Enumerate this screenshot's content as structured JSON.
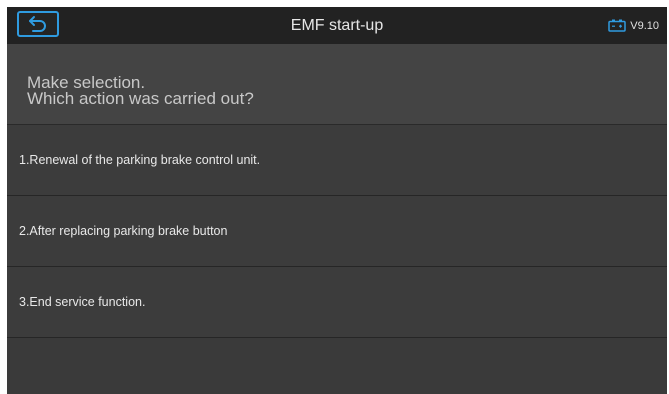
{
  "header": {
    "title": "EMF start-up",
    "version": "V9.10",
    "icons": {
      "back": "back-arrow-icon",
      "battery": "battery-icon"
    },
    "accent_color": "#2f9be0"
  },
  "prompt": {
    "line1": "Make selection.",
    "line2": "Which action was carried out?"
  },
  "options": [
    {
      "label": "1.Renewal of the parking brake control unit."
    },
    {
      "label": "2.After replacing parking brake button"
    },
    {
      "label": "3.End service function."
    }
  ]
}
